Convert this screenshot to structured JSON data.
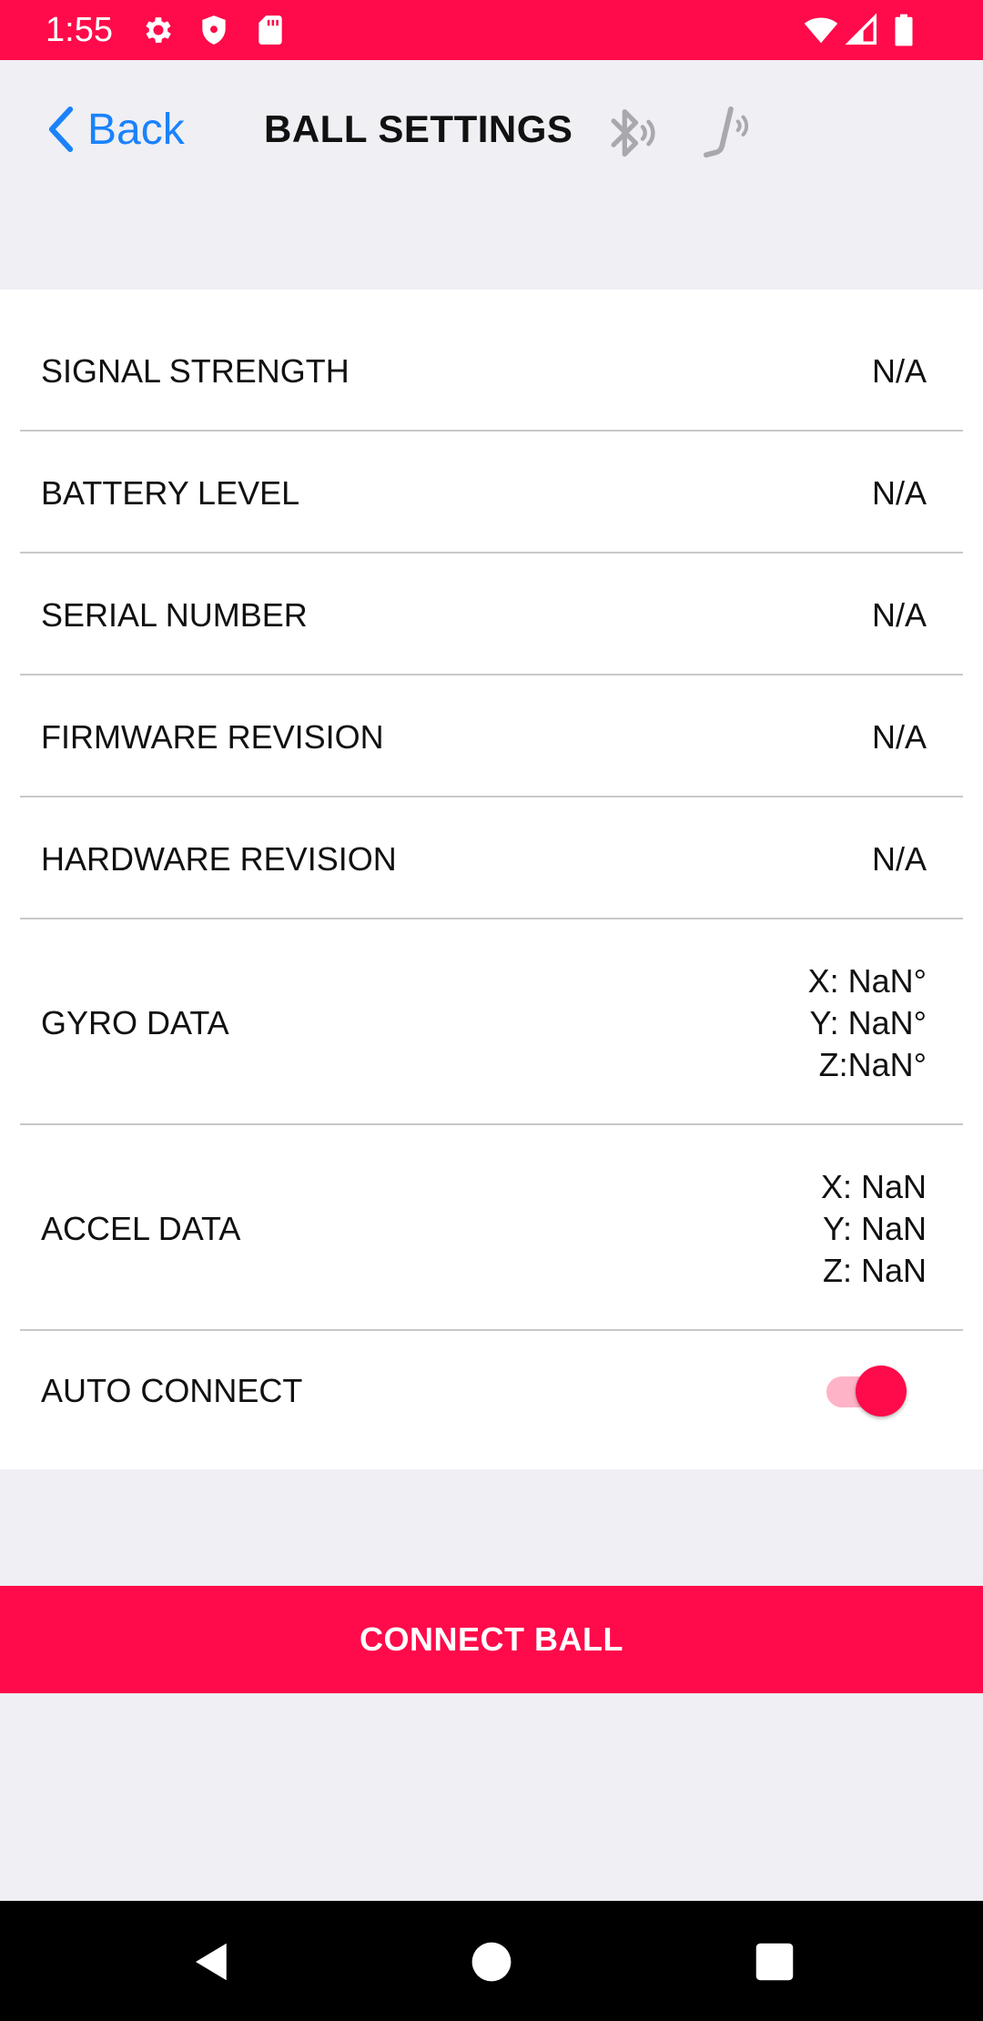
{
  "status_bar": {
    "time": "1:55",
    "background_color": "#ff0a4a",
    "left_icons": [
      "gear-icon",
      "shield-icon",
      "sd-card-icon"
    ],
    "right_icons": [
      "wifi-icon",
      "cell-signal-icon",
      "battery-icon"
    ]
  },
  "header": {
    "back_label": "Back",
    "title": "BALL SETTINGS",
    "icons": [
      "bluetooth-icon",
      "stick-sensor-icon"
    ]
  },
  "settings": {
    "rows": [
      {
        "label": "SIGNAL STRENGTH",
        "value": "N/A"
      },
      {
        "label": "BATTERY LEVEL",
        "value": "N/A"
      },
      {
        "label": "SERIAL NUMBER",
        "value": "N/A"
      },
      {
        "label": "FIRMWARE REVISION",
        "value": "N/A"
      },
      {
        "label": "HARDWARE REVISION",
        "value": "N/A"
      }
    ],
    "gyro": {
      "label": "GYRO DATA",
      "lines": [
        "X: NaN°",
        "Y: NaN°",
        "Z:NaN°"
      ]
    },
    "accel": {
      "label": "ACCEL DATA",
      "lines": [
        "X: NaN",
        "Y: NaN",
        "Z: NaN"
      ]
    },
    "auto_connect": {
      "label": "AUTO CONNECT",
      "enabled": true
    }
  },
  "connect_button": {
    "label": "CONNECT BALL"
  },
  "colors": {
    "accent": "#ff0a4a",
    "link": "#1a82fb",
    "background": "#efeff4",
    "card": "#ffffff",
    "divider": "#c8c8cc"
  },
  "nav_bar": {
    "buttons": [
      "back-triangle-icon",
      "home-circle-icon",
      "recents-square-icon"
    ]
  }
}
